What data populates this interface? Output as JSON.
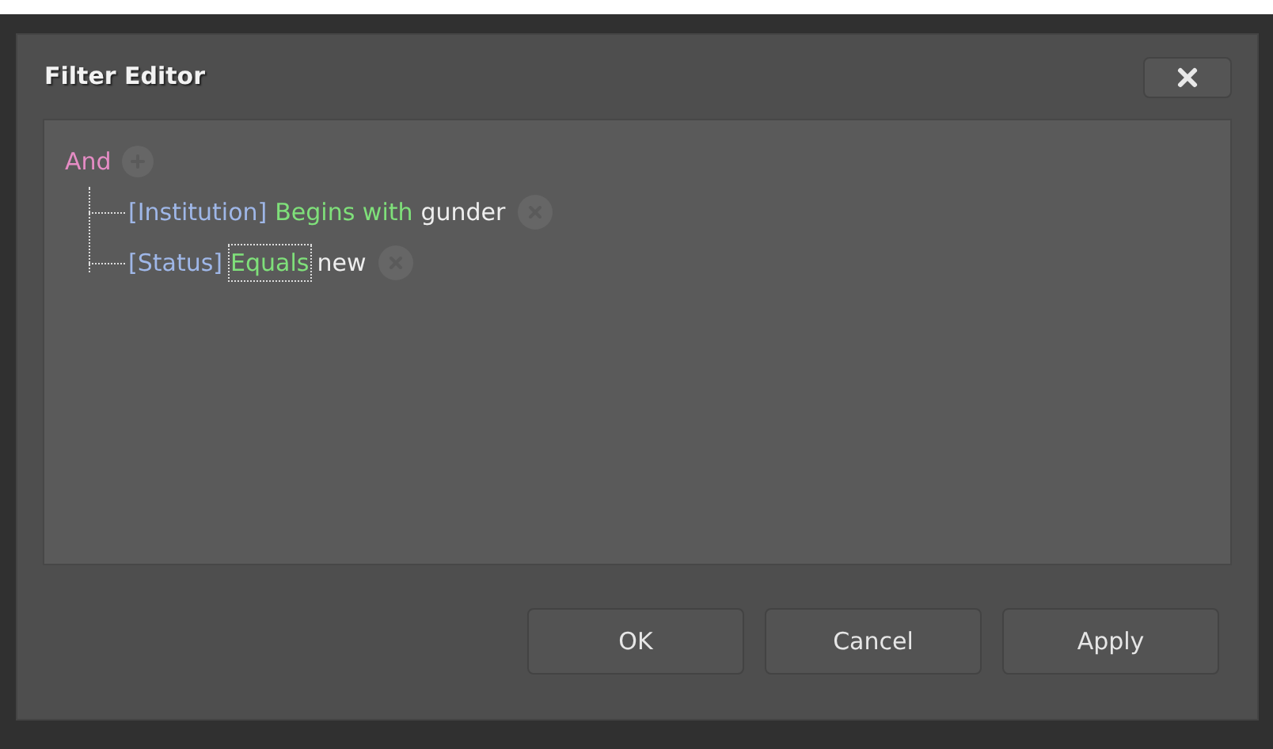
{
  "window": {
    "title": "Filter Editor"
  },
  "filter": {
    "group_operator": "And",
    "conditions": [
      {
        "field": "[Institution]",
        "operator": "Begins with",
        "value": "gunder",
        "operator_focused": false
      },
      {
        "field": "[Status]",
        "operator": "Equals",
        "value": "new",
        "operator_focused": true
      }
    ]
  },
  "buttons": [
    "OK",
    "Cancel",
    "Apply"
  ]
}
